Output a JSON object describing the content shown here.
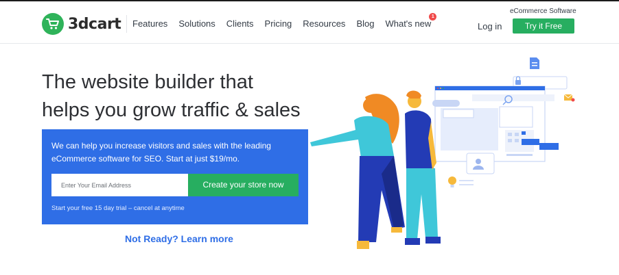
{
  "brand": {
    "logo_text": "3dcart",
    "tagline": "eCommerce Software",
    "accent_green": "#27ae60",
    "accent_blue": "#2f6ee6"
  },
  "nav": {
    "items": [
      "Features",
      "Solutions",
      "Clients",
      "Pricing",
      "Resources",
      "Blog",
      "What's new"
    ],
    "whats_new_badge": "1"
  },
  "header": {
    "login_label": "Log in",
    "try_free_label": "Try it Free"
  },
  "hero": {
    "title_line1": "The website builder that",
    "title_line2": "helps you grow traffic & sales",
    "description": "We can help you increase visitors and sales with the leading eCommerce software for SEO. Start at just $19/mo.",
    "email_placeholder": "Enter Your Email Address",
    "cta_label": "Create your store now",
    "trial_note": "Start your free 15 day trial – cancel at anytime",
    "learn_more": "Not Ready? Learn more"
  },
  "icons": [
    "cart-icon",
    "document-icon",
    "lock-icon",
    "mail-icon",
    "search-icon",
    "lightbulb-icon",
    "user-icon"
  ]
}
